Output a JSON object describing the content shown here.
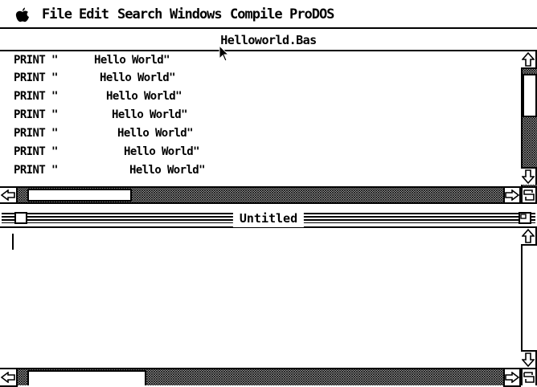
{
  "menubar": {
    "apple_icon": "apple-icon",
    "items": [
      "File",
      "Edit",
      "Search",
      "Windows",
      "Compile",
      "ProDOS"
    ]
  },
  "window1": {
    "title": "Helloworld.Bas",
    "lines": [
      {
        "keyword": "PRINT",
        "quote": "\"",
        "text": "Hello World\""
      },
      {
        "keyword": "PRINT",
        "quote": "\"",
        "text": "Hello World\""
      },
      {
        "keyword": "PRINT",
        "quote": "\"",
        "text": "Hello World\""
      },
      {
        "keyword": "PRINT",
        "quote": "\"",
        "text": "Hello World\""
      },
      {
        "keyword": "PRINT",
        "quote": "\"",
        "text": "Hello World\""
      },
      {
        "keyword": "PRINT",
        "quote": "\"",
        "text": "Hello World\""
      },
      {
        "keyword": "PRINT",
        "quote": "\"",
        "text": "Hello World\""
      }
    ],
    "scroll_up_icon": "arrow-up-icon",
    "scroll_down_icon": "arrow-down-icon",
    "scroll_left_icon": "arrow-left-icon",
    "scroll_right_icon": "arrow-right-icon",
    "grow_icon": "grow-box-icon"
  },
  "window2": {
    "title": "Untitled",
    "close_icon": "close-box-icon",
    "zoom_icon": "zoom-box-icon",
    "scroll_up_icon": "arrow-up-icon",
    "scroll_down_icon": "arrow-down-icon",
    "scroll_left_icon": "arrow-left-icon",
    "scroll_right_icon": "arrow-right-icon",
    "grow_icon": "grow-box-icon"
  }
}
